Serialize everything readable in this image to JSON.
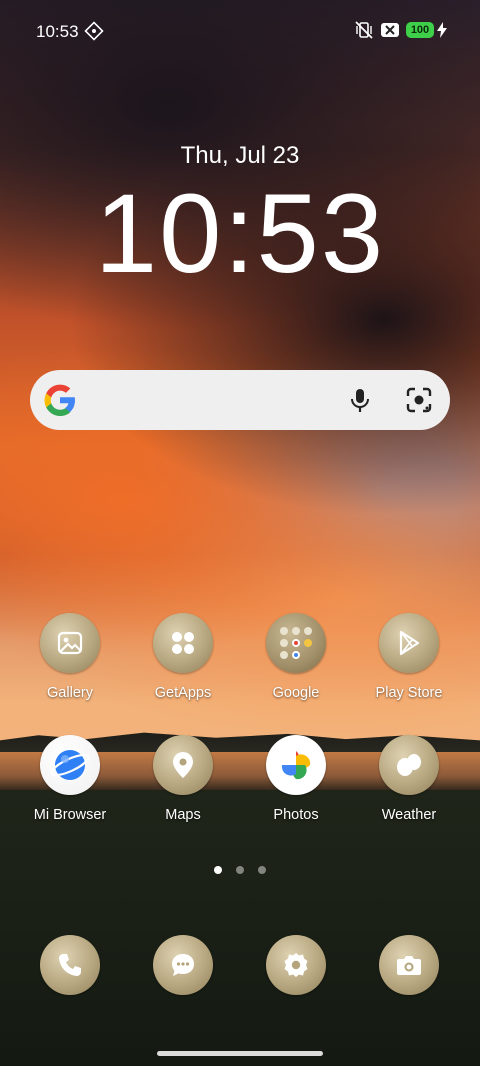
{
  "status_bar": {
    "time": "10:53",
    "battery": "100"
  },
  "clock_widget": {
    "date": "Thu, Jul 23",
    "time": "10:53"
  },
  "search_bar": {
    "placeholder": ""
  },
  "apps_row1": [
    {
      "label": "Gallery",
      "icon": "gallery-icon"
    },
    {
      "label": "GetApps",
      "icon": "getapps-icon"
    },
    {
      "label": "Google",
      "icon": "google-folder-icon"
    },
    {
      "label": "Play Store",
      "icon": "play-store-icon"
    }
  ],
  "apps_row2": [
    {
      "label": "Mi Browser",
      "icon": "mi-browser-icon"
    },
    {
      "label": "Maps",
      "icon": "maps-icon"
    },
    {
      "label": "Photos",
      "icon": "photos-icon"
    },
    {
      "label": "Weather",
      "icon": "weather-icon"
    }
  ],
  "dock": [
    {
      "icon": "phone-icon"
    },
    {
      "icon": "messages-icon"
    },
    {
      "icon": "settings-icon"
    },
    {
      "icon": "camera-icon"
    }
  ],
  "page_indicator": {
    "pages": 3,
    "active": 1
  },
  "colors": {
    "battery_green": "#3fd04a",
    "icon_bubble": "#b7a780",
    "search_bg": "#efeff0"
  }
}
